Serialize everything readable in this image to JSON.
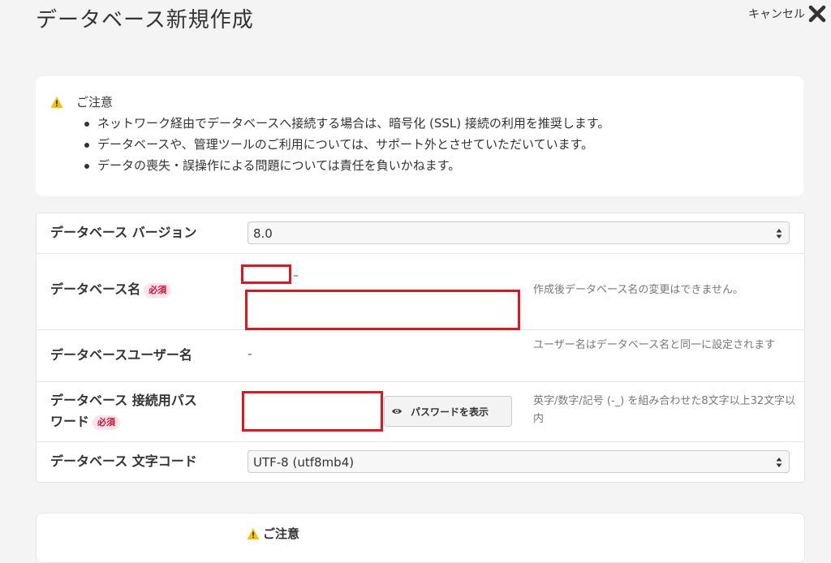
{
  "header": {
    "title": "データベース新規作成",
    "cancel_label": "キャンセル"
  },
  "notice": {
    "heading": "ご注意",
    "items": [
      "ネットワーク経由でデータベースへ接続する場合は、暗号化 (SSL) 接続の利用を推奨します。",
      "データベースや、管理ツールのご利用については、サポート外とさせていただいています。",
      "データの喪失・誤操作による問題については責任を負いかねます。"
    ]
  },
  "form": {
    "version": {
      "label": "データベース バージョン",
      "value": "8.0"
    },
    "db_name": {
      "label": "データベース名",
      "required": "必須",
      "help": "作成後データベース名の変更はできません。"
    },
    "db_user": {
      "label": "データベースユーザー名",
      "value": "-",
      "help": "ユーザー名はデータベース名と同一に設定されます"
    },
    "password": {
      "label_line1": "データベース 接続用パス",
      "label_line2": "ワード",
      "required": "必須",
      "show_button": "パスワードを表示",
      "help": "英字/数字/記号 (-_) を組み合わせた8文字以上32文字以内"
    },
    "charset": {
      "label": "データベース 文字コード",
      "value": "UTF-8 (utf8mb4)"
    }
  },
  "notice2": {
    "heading": "ご注意"
  },
  "colors": {
    "required_bg": "#fde3ea",
    "required_text": "#d0103a",
    "redact": "#e0161f",
    "warning": "#f5c400"
  },
  "icons": [
    "close-icon",
    "warning-icon",
    "select-arrows-icon",
    "eye-icon"
  ]
}
